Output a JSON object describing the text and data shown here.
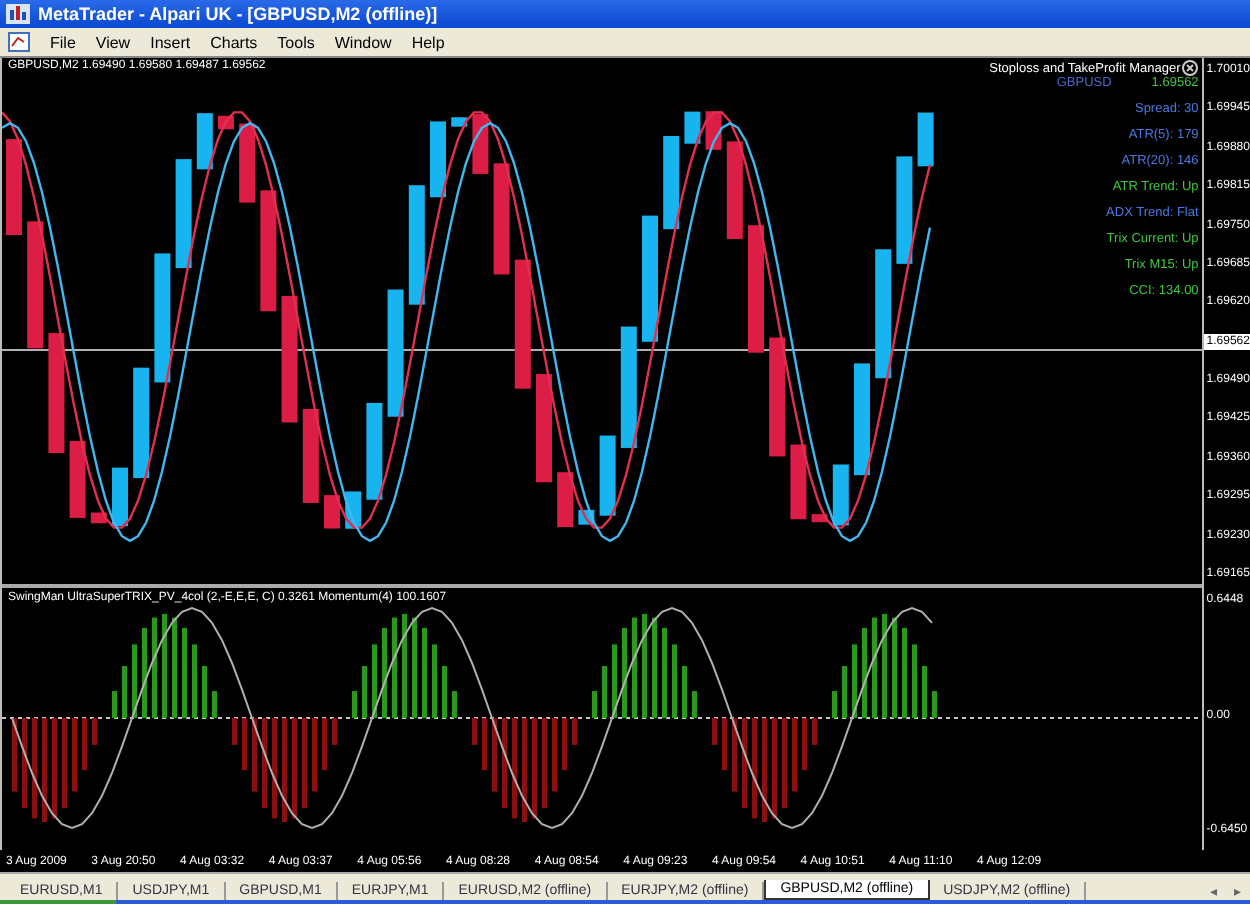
{
  "window": {
    "title": "MetaTrader - Alpari UK - [GBPUSD,M2 (offline)]"
  },
  "menu": [
    "File",
    "View",
    "Insert",
    "Charts",
    "Tools",
    "Window",
    "Help"
  ],
  "chart": {
    "header": "GBPUSD,M2  1.69490 1.69580 1.69487 1.69562",
    "price_axis": [
      {
        "label": "1.70010",
        "current": false
      },
      {
        "label": "1.69945",
        "current": false
      },
      {
        "label": "1.69880",
        "current": false
      },
      {
        "label": "1.69815",
        "current": false
      },
      {
        "label": "1.69750",
        "current": false
      },
      {
        "label": "1.69685",
        "current": false
      },
      {
        "label": "1.69620",
        "current": false
      },
      {
        "label": "1.69562",
        "current": true
      },
      {
        "label": "1.69490",
        "current": false
      },
      {
        "label": "1.69425",
        "current": false
      },
      {
        "label": "1.69360",
        "current": false
      },
      {
        "label": "1.69295",
        "current": false
      },
      {
        "label": "1.69230",
        "current": false
      },
      {
        "label": "1.69165",
        "current": false
      }
    ]
  },
  "info_panel": {
    "title": "Stoploss and TakeProfit Manager",
    "lines": [
      {
        "parts": [
          {
            "text": "GBPUSD",
            "color": "#4a68c8"
          },
          {
            "text": "1.69562",
            "color": "#3cc83c"
          }
        ]
      },
      {
        "parts": [
          {
            "text": "Spread:  30",
            "color": "#4a78e0"
          }
        ]
      },
      {
        "parts": [
          {
            "text": "ATR(5): 179",
            "color": "#4a78e0"
          }
        ]
      },
      {
        "parts": [
          {
            "text": "ATR(20): 146",
            "color": "#4a78e0"
          }
        ]
      },
      {
        "parts": [
          {
            "text": "ATR Trend: Up",
            "color": "#3cc83c"
          }
        ]
      },
      {
        "parts": [
          {
            "text": "ADX Trend: Flat",
            "color": "#4a78e0"
          }
        ]
      },
      {
        "parts": [
          {
            "text": "Trix Current: Up",
            "color": "#3cc83c"
          }
        ]
      },
      {
        "parts": [
          {
            "text": "Trix M15:  Up",
            "color": "#3cc83c"
          }
        ]
      },
      {
        "parts": [
          {
            "text": "CCI: 134.00",
            "color": "#3cc83c"
          }
        ]
      }
    ]
  },
  "indicator": {
    "label": "SwingMan UltraSuperTRIX_PV_4col (2,-E,E,E, C) 0.3261  Momentum(4) 100.1607",
    "axis": [
      "0.6448",
      "0.00",
      "-0.6450"
    ]
  },
  "time_axis": [
    "3 Aug 2009",
    "3 Aug 20:50",
    "4 Aug 03:32",
    "4 Aug 03:37",
    "4 Aug 05:56",
    "4 Aug 08:28",
    "4 Aug 08:54",
    "4 Aug 09:23",
    "4 Aug 09:54",
    "4 Aug 10:51",
    "4 Aug 11:10",
    "4 Aug 12:09"
  ],
  "tabs": [
    {
      "label": "EURUSD,M1",
      "selected": false
    },
    {
      "label": "USDJPY,M1",
      "selected": false
    },
    {
      "label": "GBPUSD,M1",
      "selected": false
    },
    {
      "label": "EURJPY,M1",
      "selected": false
    },
    {
      "label": "EURUSD,M2 (offline)",
      "selected": false
    },
    {
      "label": "EURJPY,M2 (offline)",
      "selected": false
    },
    {
      "label": "GBPUSD,M2 (offline)",
      "selected": true
    },
    {
      "label": "USDJPY,M2 (offline)",
      "selected": false
    }
  ],
  "tab_scroll": [
    "◂",
    "▸"
  ]
}
